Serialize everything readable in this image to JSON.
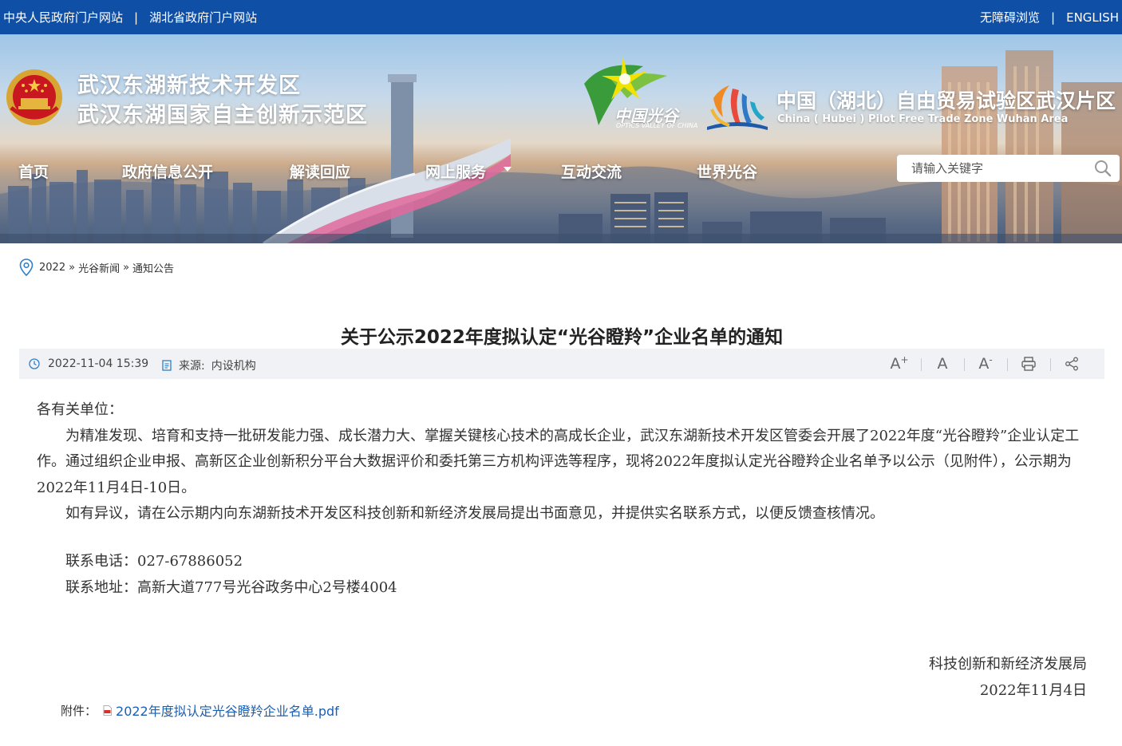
{
  "topbar": {
    "links_left": [
      "中央人民政府门户网站",
      "湖北省政府门户网站"
    ],
    "links_right": [
      "无障碍浏览",
      "ENGLISH"
    ],
    "separator": "|"
  },
  "header": {
    "site_title_line1": "武汉东湖新技术开发区",
    "site_title_line2": "武汉东湖国家自主创新示范区",
    "optics_valley_logo_text": "中国光谷",
    "optics_valley_logo_sub": "OPTICS VALLEY OF CHINA",
    "ftz_title": "中国（湖北）自由贸易试验区武汉片区",
    "ftz_subtitle": "China ( Hubei ) Pilot Free Trade Zone Wuhan Area"
  },
  "nav": {
    "items": [
      "首页",
      "政府信息公开",
      "解读回应",
      "网上服务",
      "互动交流",
      "世界光谷"
    ]
  },
  "search": {
    "placeholder": "请输入关键字"
  },
  "breadcrumb": {
    "items": [
      "2022",
      "光谷新闻",
      "通知公告"
    ],
    "separator": "»"
  },
  "article": {
    "title": "关于公示2022年度拟认定“光谷瞪羚”企业名单的通知",
    "date": "2022-11-04 15:39",
    "source_label": "来源:",
    "source_value": "内设机构",
    "tools": {
      "font_larger": "A",
      "font_larger_sign": "+",
      "font_default": "A",
      "font_smaller": "A",
      "font_smaller_sign": "-"
    },
    "salutation": "各有关单位：",
    "paragraph1": "为精准发现、培育和支持一批研发能力强、成长潜力大、掌握关键核心技术的高成长企业，武汉东湖新技术开发区管委会开展了2022年度“光谷瞪羚”企业认定工作。通过组织企业申报、高新区企业创新积分平台大数据评价和委托第三方机构评选等程序，现将2022年度拟认定光谷瞪羚企业名单予以公示（见附件），公示期为2022年11月4日-10日。",
    "paragraph2": "如有异议，请在公示期内向东湖新技术开发区科技创新和新经济发展局提出书面意见，并提供实名联系方式，以便反馈查核情况。",
    "contact_phone": "联系电话：027-67886052",
    "contact_address": "联系地址：高新大道777号光谷政务中心2号楼4004",
    "signature_org": "科技创新和新经济发展局",
    "signature_date": "2022年11月4日",
    "attachment_label": "附件：",
    "attachment_file": "2022年度拟认定光谷瞪羚企业名单.pdf"
  },
  "colors": {
    "topbar_bg": "#0f4fa6",
    "link_blue": "#1a5fb4",
    "meta_bg": "#f0f2f5"
  }
}
